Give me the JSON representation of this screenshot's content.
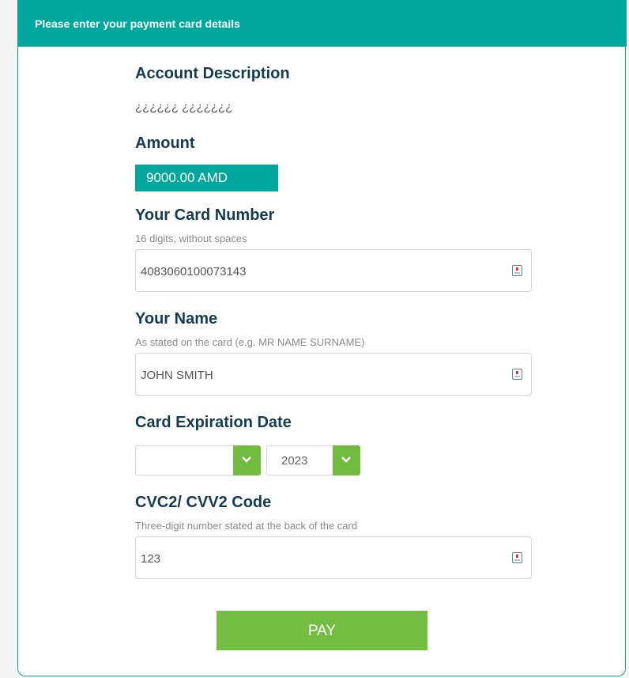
{
  "header": {
    "title": "Please enter your payment card details"
  },
  "account": {
    "label": "Account Description",
    "value": "¿¿¿¿¿¿ ¿¿¿¿¿¿¿"
  },
  "amount": {
    "label": "Amount",
    "value": "9000.00 AMD"
  },
  "card_number": {
    "label": "Your Card Number",
    "hint": "16 digits, without spaces",
    "value": "4083060100073143"
  },
  "name": {
    "label": "Your Name",
    "hint": "As stated on the card (e.g. MR NAME SURNAME)",
    "value": "JOHN SMITH"
  },
  "expiry": {
    "label": "Card Expiration Date",
    "month": "",
    "year": "2023"
  },
  "cvc": {
    "label": "CVC2/ CVV2 Code",
    "hint": "Three-digit number stated at the back of the card",
    "value": "123"
  },
  "pay": {
    "label": "PAY"
  },
  "colors": {
    "header": "#00a79c",
    "label": "#143b4f",
    "button": "#72bd42",
    "dropdown_arrow": "#71bb40"
  }
}
